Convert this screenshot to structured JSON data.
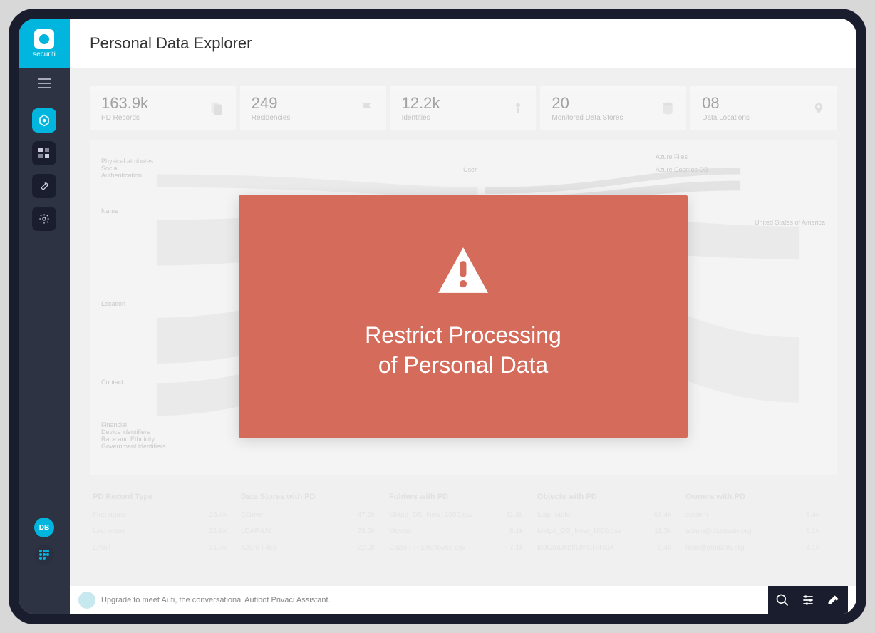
{
  "brand": {
    "name": "securiti"
  },
  "header": {
    "title": "Personal Data Explorer"
  },
  "stats": [
    {
      "value": "163.9k",
      "label": "PD Records",
      "icon": "files-icon"
    },
    {
      "value": "249",
      "label": "Residencies",
      "icon": "flag-icon"
    },
    {
      "value": "12.2k",
      "label": "Identities",
      "icon": "person-icon"
    },
    {
      "value": "20",
      "label": "Monitored Data Stores",
      "icon": "database-icon"
    },
    {
      "value": "08",
      "label": "Data Locations",
      "icon": "location-icon"
    }
  ],
  "sankey": {
    "left_groups": [
      "Physical attributes",
      "Social",
      "Authentication",
      "Name",
      "Location",
      "Contact",
      "Financial",
      "Device identifiers",
      "Race and Ethnicity",
      "Government identifiers"
    ],
    "mid": "User",
    "right_top": [
      "Azure Files",
      "Azure Cosmos DB"
    ],
    "right_country": "United States of America"
  },
  "table": {
    "headers": [
      "PD Record Type",
      "Data Stores with PD",
      "Folders with PD",
      "Objects with PD",
      "Owners with PD"
    ],
    "rows": [
      {
        "c0": "First name",
        "v0": "26.4k",
        "c1": "GDrive",
        "v1": "47.2k",
        "c2": "Mktpd_DS_New_1000.csv",
        "v2": "11.3k",
        "c3": "ldap_table",
        "v3": "63.4k",
        "c4": "system",
        "v4": "8.4k"
      },
      {
        "c0": "Last name",
        "v0": "21.9k",
        "c1": "LDAP-LN",
        "v1": "23.6k",
        "c2": "Movies",
        "v2": "8.1k",
        "c3": "Mktpd_DS_New_1000.csv",
        "v3": "11.3k",
        "c4": "admin@dsamain.org",
        "v4": "8.1k"
      },
      {
        "c0": "Email",
        "v0": "21.7k",
        "c1": "Azure Files",
        "v1": "22.3k",
        "c2": "Class HR Employee.csv",
        "v2": "7.1k",
        "c3": "IntlGroDept/DMGR/RBA",
        "v3": "8.4k",
        "c4": "rosa@amazon.org",
        "v4": "4.1k"
      }
    ]
  },
  "sidebar": {
    "avatar_initials": "DB"
  },
  "footer": {
    "hint": "Upgrade to meet Auti, the conversational Autibot Privaci Assistant."
  },
  "modal": {
    "line1": "Restrict Processing",
    "line2": "of Personal Data"
  },
  "colors": {
    "accent": "#00b6de",
    "modal_bg": "#d56b5b",
    "sidebar_bg": "#2d3343"
  }
}
